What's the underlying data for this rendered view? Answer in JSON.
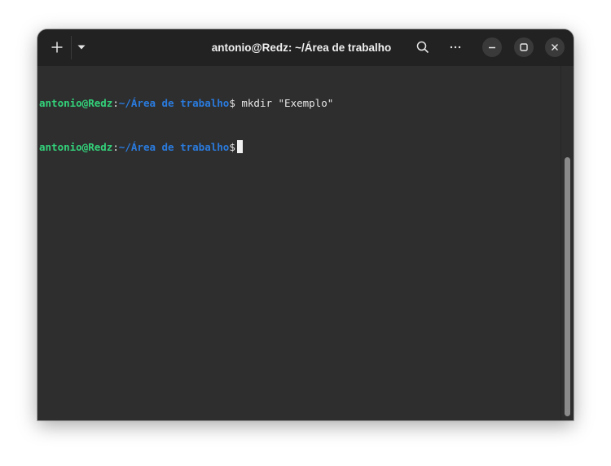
{
  "window": {
    "title": "antonio@Redz: ~/Área de trabalho"
  },
  "headerbar": {
    "new_tab_icon": "plus-icon",
    "tab_menu_icon": "chevron-down-icon",
    "search_icon": "search-icon",
    "menu_icon": "ellipsis-icon",
    "minimize_icon": "minimize-icon",
    "maximize_icon": "maximize-icon",
    "close_icon": "close-icon"
  },
  "terminal": {
    "lines": [
      {
        "user": "antonio@Redz",
        "colon": ":",
        "path": "~/Área de trabalho",
        "dollar": "$",
        "command": " mkdir \"Exemplo\""
      },
      {
        "user": "antonio@Redz",
        "colon": ":",
        "path": "~/Área de trabalho",
        "dollar": "$",
        "command": " "
      }
    ]
  },
  "colors": {
    "user": "#33d17a",
    "path": "#2a7bde",
    "background": "#2e2e2e",
    "headerbar": "#222222"
  }
}
